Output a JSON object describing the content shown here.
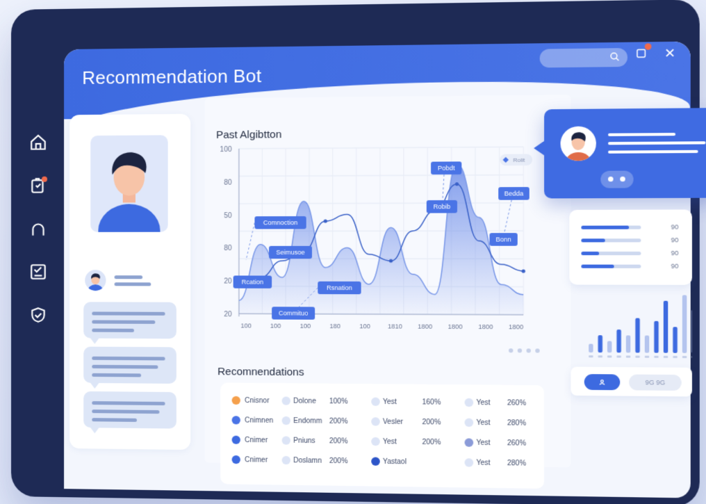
{
  "app": {
    "title": "Recommendation Bot"
  },
  "header": {
    "search_icon": "search-icon",
    "window_icon": "window-icon",
    "close_icon": "close-icon",
    "close_glyph": "✕"
  },
  "sidebar": {
    "items": [
      {
        "icon": "home-icon"
      },
      {
        "icon": "clipboard-alert-icon"
      },
      {
        "icon": "user-icon"
      },
      {
        "icon": "checklist-icon"
      },
      {
        "icon": "shield-icon"
      }
    ]
  },
  "chart_panel": {
    "title": "Past Algibtton",
    "legend_label": "Rolit",
    "y_ticks": [
      "100",
      "80",
      "50",
      "80",
      "20",
      "20"
    ],
    "x_ticks": [
      "100",
      "100",
      "100",
      "180",
      "100",
      "1810",
      "1800",
      "1800",
      "1800",
      "1800"
    ],
    "nodes": [
      "Comnoction",
      "Seimusoe",
      "Rcation",
      "Rsnation",
      "Commituo",
      "Pobdt",
      "Robib",
      "Bedda",
      "Bonn"
    ]
  },
  "chart_data": {
    "type": "area",
    "title": "Past Algibtton",
    "xlabel": "",
    "ylabel": "",
    "y_tick_labels": [
      "100",
      "80",
      "50",
      "80",
      "20",
      "20"
    ],
    "x_tick_labels": [
      "100",
      "100",
      "100",
      "180",
      "100",
      "1810",
      "1800",
      "1800",
      "1800",
      "1800"
    ],
    "grid": true,
    "series": [
      {
        "values": [
          8,
          42,
          22,
          68,
          28,
          40,
          18,
          52,
          24,
          12,
          90,
          58,
          18,
          12
        ]
      },
      {
        "values": [
          16,
          22,
          32,
          38,
          56,
          60,
          36,
          32,
          50,
          62,
          78,
          44,
          30,
          26
        ]
      }
    ]
  },
  "recommendations": {
    "title": "Recomnendations",
    "rows": [
      {
        "dot_color": "#f5a04c",
        "name": "Cnisnor",
        "dot2_color": "#dce4f6",
        "item": "Dolone",
        "pct": "100%",
        "dot3_color": "#dce4f6",
        "tag": "Yest",
        "pct2": "160%",
        "dot4_color": "#dce4f6",
        "tag2": "Yest",
        "pct3": "260%"
      },
      {
        "dot_color": "#4a74e6",
        "name": "Cnimnen",
        "dot2_color": "#dce4f6",
        "item": "Endomm",
        "pct": "200%",
        "dot3_color": "#dce4f6",
        "tag": "Vesler",
        "pct2": "200%",
        "dot4_color": "#dce4f6",
        "tag2": "Yest",
        "pct3": "280%"
      },
      {
        "dot_color": "#3d6ae0",
        "name": "Cnimer",
        "dot2_color": "#dce4f6",
        "item": "Pniuns",
        "pct": "200%",
        "dot3_color": "#dce4f6",
        "tag": "Yest",
        "pct2": "200%",
        "dot4_color": "#8b9bd8",
        "tag2": "Yest",
        "pct3": "260%"
      },
      {
        "dot_color": "#3d6ae0",
        "name": "Cnimer",
        "dot2_color": "#dce4f6",
        "item": "Doslamn",
        "pct": "200%",
        "dot3_color": "#2d55c8",
        "tag": "Yastaol",
        "pct2": "",
        "dot4_color": "#dce4f6",
        "tag2": "Yest",
        "pct3": "280%"
      }
    ]
  },
  "stats": {
    "values": [
      "90",
      "90",
      "90",
      "90"
    ],
    "fills": [
      0.8,
      0.4,
      0.3,
      0.55
    ]
  },
  "bars": {
    "values": [
      0.15,
      0.3,
      0.2,
      0.4,
      0.3,
      0.6,
      0.3,
      0.55,
      0.9,
      0.45,
      1.0,
      0.75
    ],
    "accent_mask": [
      0,
      1,
      0,
      1,
      0,
      1,
      0,
      1,
      1,
      1,
      0,
      0
    ]
  },
  "bars_footer": {
    "left_label": "",
    "right_label": "9G 9G"
  },
  "colors": {
    "accent": "#3d6ae0",
    "frame": "#1e2a55",
    "bg": "#f3f6fd"
  }
}
